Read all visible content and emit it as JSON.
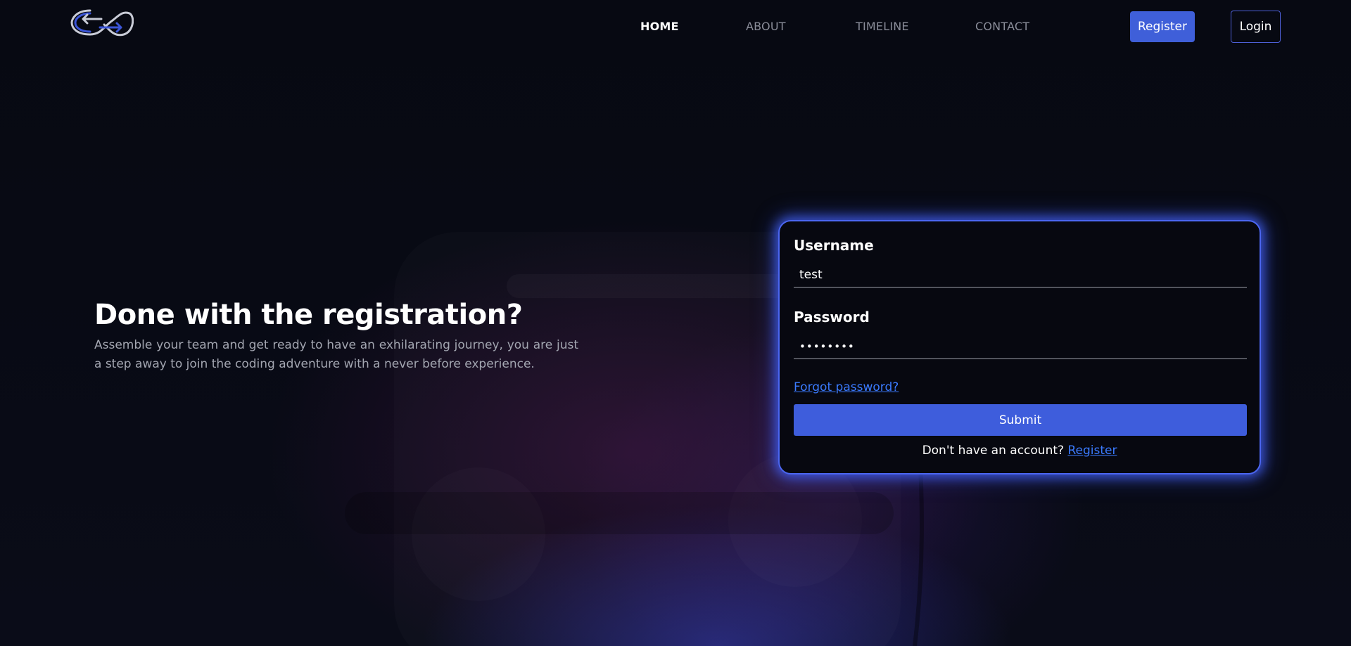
{
  "brand": {
    "logo_icon": "infinity-arrows-logo",
    "accent_color": "#3f5fd9"
  },
  "nav": {
    "home": "HOME",
    "about": "ABOUT",
    "timeline": "TIMELINE",
    "contact": "CONTACT",
    "active": "HOME",
    "register_label": "Register",
    "login_label": "Login"
  },
  "hero": {
    "title": "Done with the registration?",
    "text": "Assemble your team and get ready to have an exhilarating journey, you are just a step away to join the coding adventure with a never before experience."
  },
  "login_form": {
    "username_label": "Username",
    "username_value": "test",
    "password_label": "Password",
    "password_value": "••••••••",
    "forgot_label": "Forgot password?",
    "submit_label": "Submit",
    "no_account_text": "Don't have an account?",
    "register_link": "Register",
    "glow_color": "#4b66f0",
    "link_color": "#3b7bff"
  }
}
